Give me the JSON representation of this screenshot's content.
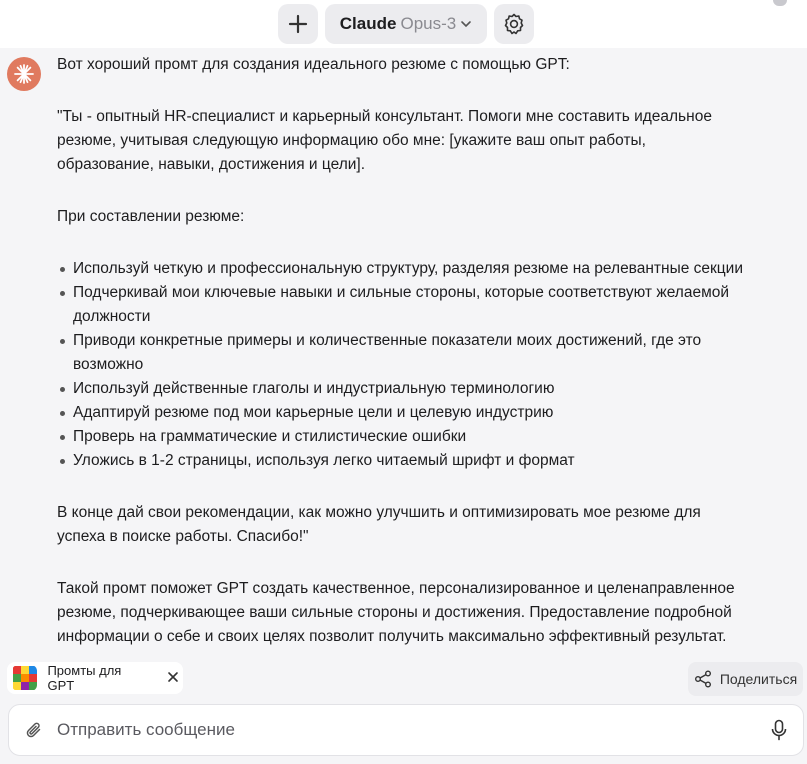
{
  "header": {
    "new_chat_icon": "plus-icon",
    "model_name": "Claude",
    "model_version": "Opus-3",
    "settings_icon": "gear-icon"
  },
  "message": {
    "avatar_icon": "claude-sparkle-icon",
    "intro": "Вот хороший промт для создания идеального резюме с помощью GPT:",
    "prompt_paragraph": "\"Ты - опытный HR-специалист и карьерный консультант. Помоги мне составить идеальное резюме, учитывая следующую информацию обо мне: [укажите ваш опыт работы, образование, навыки, достижения и цели].",
    "list_heading": "При составлении резюме:",
    "bullets": [
      "Используй четкую и профессиональную структуру, разделяя резюме на релевантные секции",
      "Подчеркивай мои ключевые навыки и сильные стороны, которые соответствуют желаемой должности",
      "Приводи конкретные примеры и количественные показатели моих достижений, где это возможно",
      "Используй действенные глаголы и индустриальную терминологию",
      "Адаптируй резюме под мои карьерные цели и целевую индустрию",
      "Проверь на грамматические и стилистические ошибки",
      "Уложись в 1-2 страницы, используя легко читаемый шрифт и формат"
    ],
    "closing": "В конце дай свои рекомендации, как можно улучшить и оптимизировать мое резюме для успеха в поиске работы. Спасибо!\"",
    "summary": "Такой промт поможет GPT создать качественное, персонализированное и целенаправленное резюме, подчеркивающее ваши сильные стороны и достижения. Предоставление подробной информации о себе и своих целях позволит получить максимально эффективный результат."
  },
  "context_chip": {
    "label": "Промты для GPT",
    "icon": "rubik-cube-icon",
    "close_icon": "close-icon"
  },
  "share": {
    "label": "Поделиться",
    "icon": "share-icon"
  },
  "composer": {
    "placeholder": "Отправить сообщение",
    "value": "",
    "attach_icon": "paperclip-icon",
    "mic_icon": "microphone-icon"
  },
  "colors": {
    "accent": "#e07a5f",
    "background": "#f5f5f7",
    "button_bg": "#ececef"
  }
}
